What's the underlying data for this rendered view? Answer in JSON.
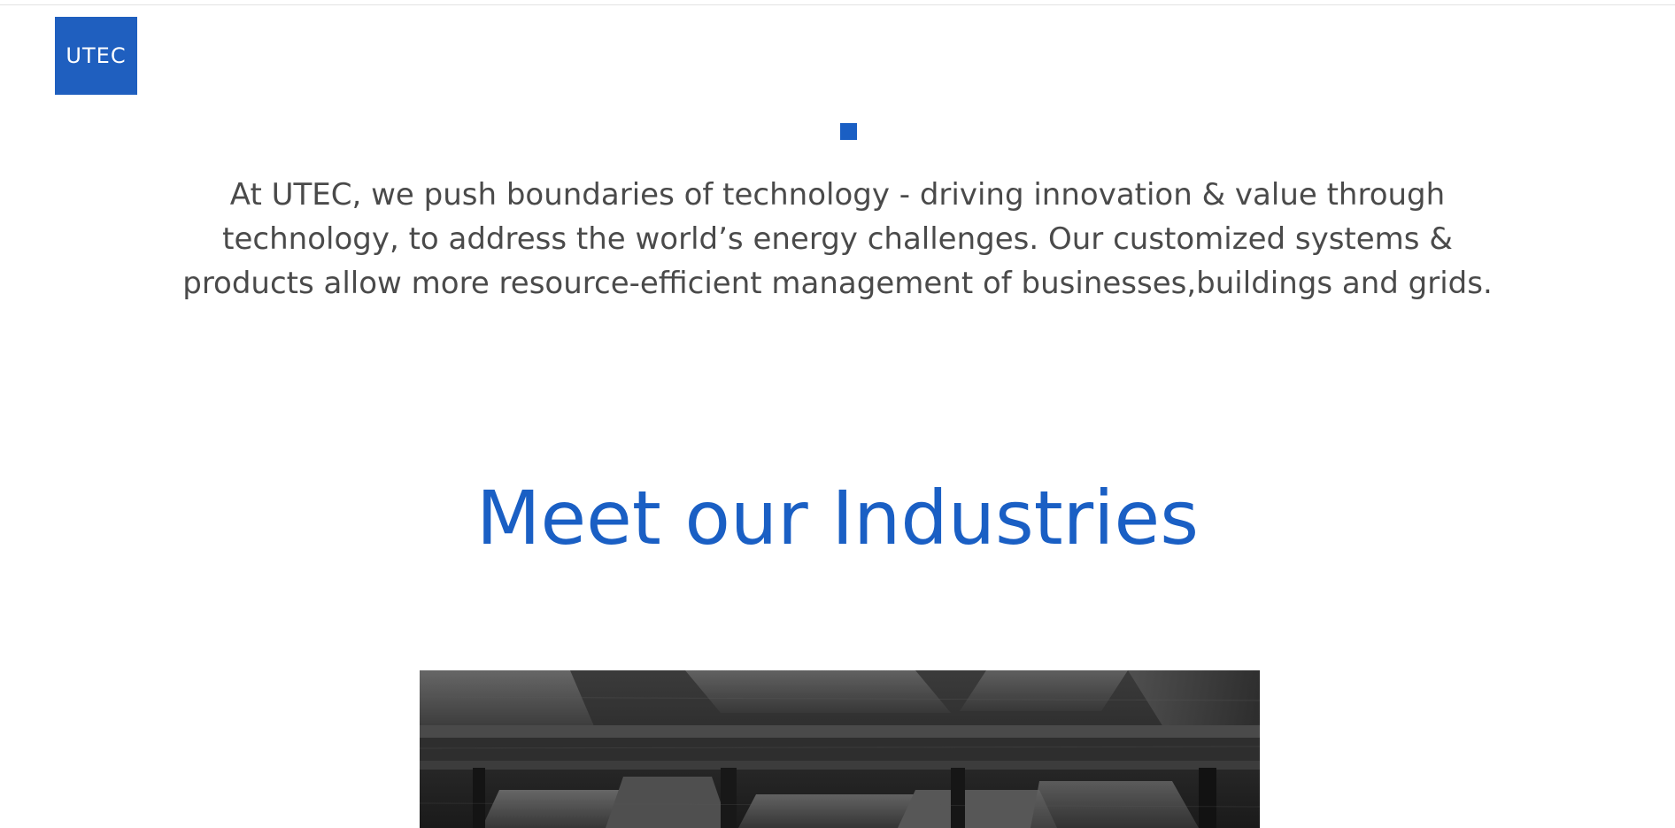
{
  "logo": {
    "text": "UTEC"
  },
  "intro": {
    "text": "At UTEC, we push boundaries of technology - driving innovation & value through technology, to address the world’s energy challenges. Our customized systems & products allow more resource-efficient management of businesses,buildings and grids."
  },
  "industries": {
    "heading": "Meet our Industries"
  },
  "colors": {
    "brand_blue": "#1a5fc4",
    "logo_blue": "#1f5fbf",
    "body_text": "#4a4a4a"
  }
}
